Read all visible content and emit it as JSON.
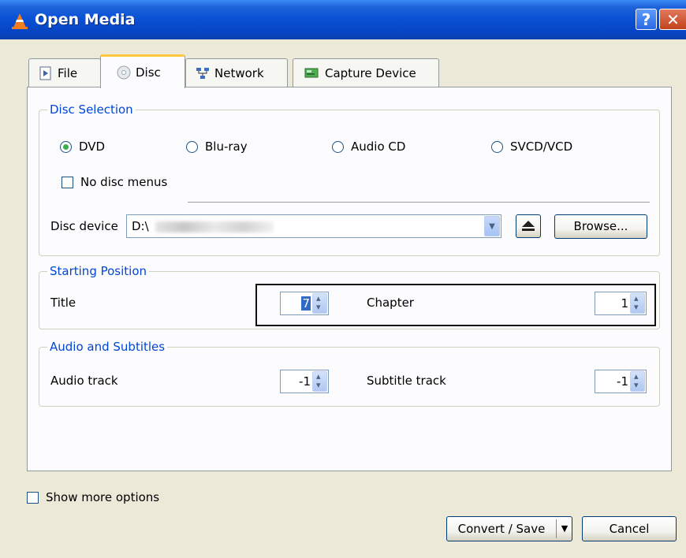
{
  "window": {
    "title": "Open Media",
    "help_label": "?",
    "close_label": "✕"
  },
  "tabs": [
    {
      "label": "File",
      "icon": "file-play-icon"
    },
    {
      "label": "Disc",
      "icon": "disc-icon",
      "active": true
    },
    {
      "label": "Network",
      "icon": "network-icon"
    },
    {
      "label": "Capture Device",
      "icon": "capture-card-icon"
    }
  ],
  "disc_selection": {
    "legend": "Disc Selection",
    "options": [
      "DVD",
      "Blu-ray",
      "Audio CD",
      "SVCD/VCD"
    ],
    "selected": "DVD",
    "no_disc_menus_label": "No disc menus",
    "no_disc_menus_checked": false,
    "disc_device_label": "Disc device",
    "disc_device_value": "D:\\",
    "browse_label": "Browse..."
  },
  "starting_position": {
    "legend": "Starting Position",
    "title_label": "Title",
    "title_value": "7",
    "chapter_label": "Chapter",
    "chapter_value": "1"
  },
  "audio_subtitles": {
    "legend": "Audio and Subtitles",
    "audio_label": "Audio track",
    "audio_value": "-1",
    "subtitle_label": "Subtitle track",
    "subtitle_value": "-1"
  },
  "footer": {
    "show_more_options_label": "Show more options",
    "show_more_options_checked": false,
    "convert_label": "Convert / Save",
    "cancel_label": "Cancel"
  },
  "colors": {
    "titlebar": "#0a52d6",
    "legend": "#0046d5",
    "active_tab_accent": "#ffc73c",
    "dialog_bg": "#ece9d8"
  }
}
